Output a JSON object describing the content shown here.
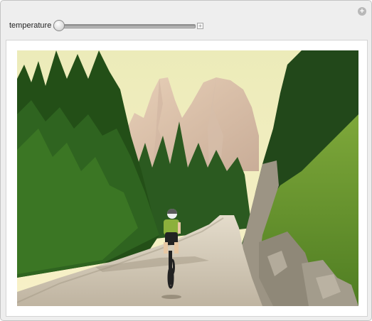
{
  "control": {
    "label": "temperature",
    "slider_value_fraction": 0.0,
    "plus_glyph": "+"
  },
  "panel": {
    "corner_icon": "plus-circle-icon",
    "corner_glyph": "+"
  },
  "image": {
    "description_icon": "photo-mountain-bike-trail"
  },
  "colors": {
    "panel_bg": "#eeeeee",
    "display_bg": "#ffffff",
    "sky": "#f4eec0",
    "forest": "#2f5a1a",
    "road": "#cfc6b3"
  }
}
